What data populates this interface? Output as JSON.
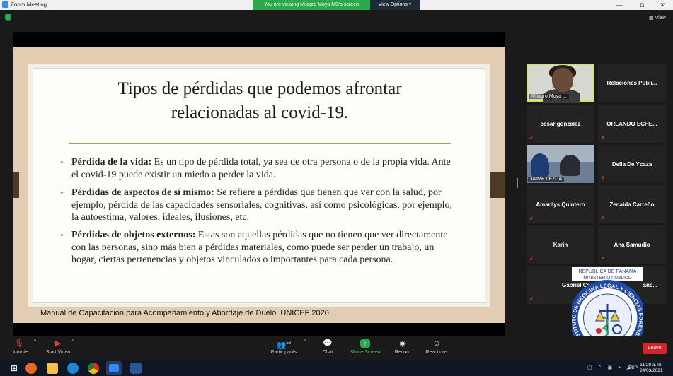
{
  "window": {
    "app_title": "Zoom Meeting",
    "viewing_banner": "You are viewing Milagro Moya MD's screen",
    "view_options": "View Options",
    "controls": {
      "minimize": "—",
      "maximize": "⧉",
      "close": "✕"
    }
  },
  "view_button": "View",
  "slide": {
    "title_line1": "Tipos de pérdidas que podemos afrontar",
    "title_line2": "relacionadas al covid-19.",
    "bullets": [
      {
        "heading": "Pérdida de la vida:",
        "text": " Es un tipo de pérdida total, ya sea de otra persona o de la propia vida. Ante el covid-19 puede existir un miedo a perder la vida."
      },
      {
        "heading": "Pérdidas de aspectos de sí mismo:",
        "text": " Se refiere a pérdidas que tienen que ver con la salud, por ejemplo, pérdida de las capacidades sensoriales, cognitivas, así como psicológicas, por ejemplo, la autoestima, valores, ideales, ilusiones, etc."
      },
      {
        "heading": "Pérdidas de objetos externos:",
        "text": " Estas son aquellas pérdidas que no tienen que ver directamente con las personas, sino más bien a pérdidas materiales, como puede ser perder un trabajo, un hogar, ciertas pertenencias y objetos vinculados o importantes para cada persona."
      }
    ],
    "footer": "Manual de Capacitación para Acompañamiento y Abordaje de Duelo. UNICEF 2020"
  },
  "participants": [
    {
      "name": "Milagro Moya ...",
      "video": true,
      "muted": false
    },
    {
      "name": "Relaciones  Públi...",
      "video": false,
      "muted": false
    },
    {
      "name": "cesar gonzalez",
      "video": false,
      "muted": true
    },
    {
      "name": "ORLANDO  ECHE...",
      "video": false,
      "muted": true
    },
    {
      "name": "JAIME LEZCA",
      "video": true,
      "muted": false
    },
    {
      "name": "Delia De Ycaza",
      "video": false,
      "muted": true
    },
    {
      "name": "Amarilys Quintero",
      "video": false,
      "muted": true
    },
    {
      "name": "Zenaida Carreño",
      "video": false,
      "muted": true
    },
    {
      "name": "Karin",
      "video": false,
      "muted": true
    },
    {
      "name": "Ana Samudio",
      "video": false,
      "muted": true
    },
    {
      "name": "Gabriel Ca",
      "video": false,
      "muted": true
    },
    {
      "name": "anc...",
      "video": false,
      "muted": true
    }
  ],
  "seal": {
    "top_line1": "REPÚBLICA DE PANAMÁ",
    "top_line2": "MINISTERIO PÚBLICO",
    "ring_text": "INSTITUTO DE MEDICINA LEGAL Y CIENCIAS FORENSES"
  },
  "toolbar": {
    "unmute": "Unmute",
    "start_video": "Start Video",
    "participants": "Participants",
    "participants_count": "53",
    "chat": "Chat",
    "share_screen": "Share Screen",
    "record": "Record",
    "reactions": "Reactions",
    "leave": "Leave"
  },
  "taskbar": {
    "time": "11:29 a. m.",
    "date": "24/03/2021",
    "language": "ESP"
  }
}
